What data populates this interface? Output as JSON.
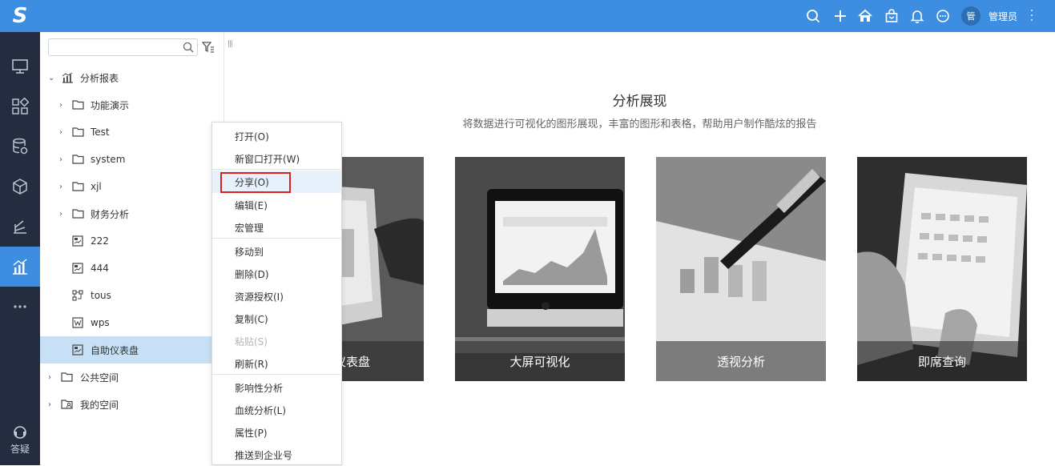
{
  "app": {
    "logo_text": "S",
    "accent": "#3d8ee0",
    "rail_bg": "#232d3f"
  },
  "rail": {
    "items": [
      {
        "icon": "monitor-icon"
      },
      {
        "icon": "apps-icon"
      },
      {
        "icon": "database-icon"
      },
      {
        "icon": "cube-icon"
      },
      {
        "icon": "layers-icon"
      },
      {
        "icon": "chart-icon",
        "active": true
      },
      {
        "icon": "more-icon"
      }
    ],
    "help_label": "答疑"
  },
  "topbar": {
    "icons": [
      "search-icon",
      "plus-icon",
      "home-icon",
      "bag-icon",
      "bell-icon",
      "chat-icon"
    ],
    "avatar_text": "管",
    "username": "管理员"
  },
  "tree": {
    "search_placeholder": "",
    "rows": [
      {
        "label": "分析报表",
        "type": "root-report",
        "expanded": true
      },
      {
        "label": "功能演示",
        "type": "folder"
      },
      {
        "label": "Test",
        "type": "folder"
      },
      {
        "label": "system",
        "type": "folder"
      },
      {
        "label": "xjl",
        "type": "folder"
      },
      {
        "label": "财务分析",
        "type": "folder"
      },
      {
        "label": "222",
        "type": "dashboard"
      },
      {
        "label": "444",
        "type": "dashboard"
      },
      {
        "label": "tous",
        "type": "flow"
      },
      {
        "label": "wps",
        "type": "wps"
      },
      {
        "label": "自助仪表盘",
        "type": "dashboard",
        "selected": true
      },
      {
        "label": "公共空间",
        "type": "folder-root"
      },
      {
        "label": "我的空间",
        "type": "person-root"
      }
    ]
  },
  "main": {
    "title": "分析展现",
    "subtitle": "将数据进行可视化的图形展现，丰富的图形和表格，帮助用户制作酷炫的报告",
    "cards": [
      {
        "caption": "自助仪表盘",
        "visible_caption": "仪表盘"
      },
      {
        "caption": "大屏可视化"
      },
      {
        "caption": "透视分析"
      },
      {
        "caption": "即席查询"
      }
    ]
  },
  "context_menu": {
    "items": [
      {
        "label": "打开(O)"
      },
      {
        "label": "新窗口打开(W)"
      },
      {
        "label": "分享(O)",
        "highlight": true
      },
      {
        "label": "编辑(E)"
      },
      {
        "label": "宏管理"
      },
      {
        "label": "移动到"
      },
      {
        "label": "删除(D)"
      },
      {
        "label": "资源授权(I)"
      },
      {
        "label": "复制(C)"
      },
      {
        "label": "粘贴(S)",
        "disabled": true
      },
      {
        "label": "刷新(R)"
      },
      {
        "label": "影响性分析"
      },
      {
        "label": "血统分析(L)"
      },
      {
        "label": "属性(P)"
      },
      {
        "label": "推送到企业号"
      }
    ]
  }
}
